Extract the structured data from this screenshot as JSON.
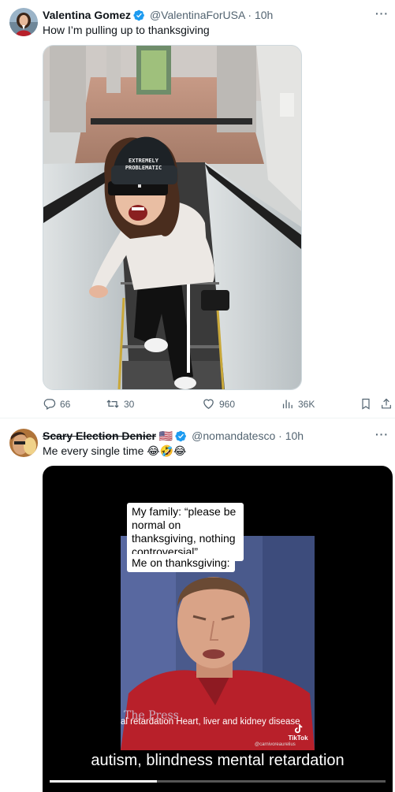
{
  "tweets": [
    {
      "display_name": "Valentina Gomez",
      "handle": "@ValentinaForUSA",
      "separator": "·",
      "time": "10h",
      "text": "How I’m pulling up to thanksgiving",
      "beanie_text": "EXTREMELY PROBLEMATIC",
      "stats": {
        "replies": "66",
        "retweets": "30",
        "likes": "960",
        "views": "36K"
      }
    },
    {
      "display_name": "Scary Election Denier",
      "flag": "🇺🇸",
      "handle": "@nomandatesco",
      "separator": "·",
      "time": "10h",
      "text": "Me every single time 😂🤣😂",
      "video": {
        "caption_1": "My family: “please be normal on thanksgiving, nothing controversial”",
        "caption_2": "Me on thanksgiving:",
        "inner_caption": "al retardation Heart, liver and kidney disease",
        "watermark_show": "The Press",
        "tiktok_label": "TikTok",
        "tiktok_user": "@carnivoreaurelius",
        "subtitle": "autism, blindness mental retardation"
      }
    }
  ],
  "icons": [
    "verified-badge-icon",
    "more-icon",
    "reply-icon",
    "retweet-icon",
    "like-icon",
    "views-icon",
    "bookmark-icon",
    "share-icon",
    "tiktok-icon"
  ],
  "colors": {
    "verified": "#1d9bf0",
    "text_primary": "#0f1419",
    "text_secondary": "#536471",
    "border": "#cfd9de"
  }
}
